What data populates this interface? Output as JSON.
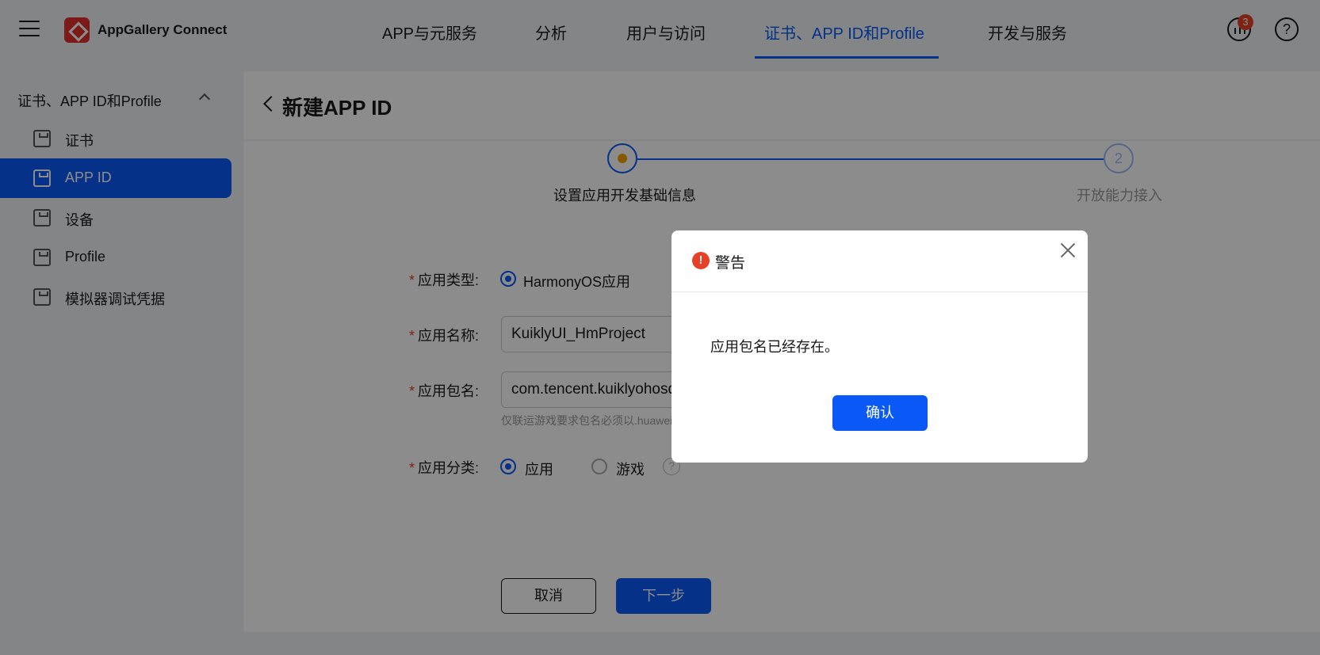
{
  "app": {
    "brand": "AppGallery Connect",
    "notification_count": "3",
    "help_glyph": "?"
  },
  "nav": {
    "tabs": [
      {
        "label": "APP与元服务"
      },
      {
        "label": "分析"
      },
      {
        "label": "用户与访问"
      },
      {
        "label": "证书、APP ID和Profile"
      },
      {
        "label": "开发与服务"
      }
    ],
    "active_tab": "证书、APP ID和Profile"
  },
  "sidebar": {
    "group_label": "证书、APP ID和Profile",
    "items": [
      {
        "label": "证书"
      },
      {
        "label": "APP ID"
      },
      {
        "label": "设备"
      },
      {
        "label": "Profile"
      },
      {
        "label": "模拟器调试凭据"
      }
    ],
    "active_item": "APP ID"
  },
  "page": {
    "title": "新建APP ID"
  },
  "steps": [
    {
      "label": "设置应用开发基础信息",
      "state": "current"
    },
    {
      "number": "2",
      "label": "开放能力接入",
      "state": "pending"
    }
  ],
  "form": {
    "required_mark": "*",
    "app_type": {
      "label": "应用类型:",
      "option": "HarmonyOS应用"
    },
    "app_name": {
      "label": "应用名称:",
      "value": "KuiklyUI_HmProject"
    },
    "package_name": {
      "label": "应用包名:",
      "value": "com.tencent.kuiklyohosdemo",
      "hint": "仅联运游戏要求包名必须以.huawei结尾"
    },
    "category": {
      "label": "应用分类:",
      "options": [
        "应用",
        "游戏"
      ],
      "selected": "应用",
      "help_glyph": "?"
    }
  },
  "actions": {
    "cancel_label": "取消",
    "next_label": "下一步"
  },
  "dialog": {
    "icon_glyph": "!",
    "title": "警告",
    "message": "应用包名已经存在。",
    "confirm_label": "确认"
  },
  "colors": {
    "accent": "#0a59f7",
    "warning": "#e84026",
    "step_dot": "#f4a100"
  }
}
